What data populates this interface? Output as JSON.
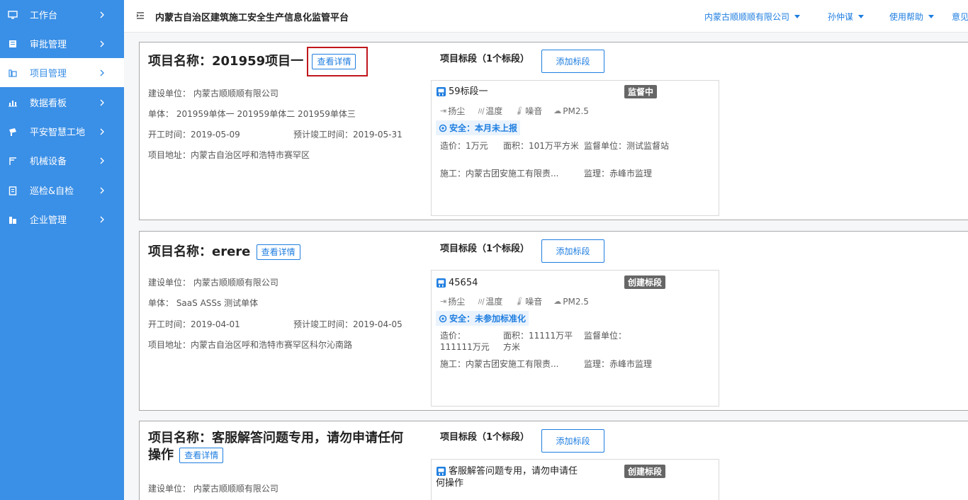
{
  "sidebar": {
    "items": [
      {
        "label": "工作台",
        "icon": "monitor-icon"
      },
      {
        "label": "审批管理",
        "icon": "approval-icon"
      },
      {
        "label": "项目管理",
        "icon": "project-icon"
      },
      {
        "label": "数据看板",
        "icon": "chart-icon"
      },
      {
        "label": "平安智慧工地",
        "icon": "camera-icon"
      },
      {
        "label": "机械设备",
        "icon": "crane-icon"
      },
      {
        "label": "巡检&自检",
        "icon": "clipboard-icon"
      },
      {
        "label": "企业管理",
        "icon": "building-icon"
      }
    ],
    "active_index": 2
  },
  "header": {
    "title": "内蒙古自治区建筑施工安全生产信息化监管平台",
    "company": "内蒙古顺顺顺有限公司",
    "user": "孙仲谋",
    "help": "使用帮助",
    "feedback": "意见"
  },
  "colors": {
    "sidebar": "#3a8fe6",
    "accent": "#1f7ee0",
    "highlight": "#c0171c"
  },
  "projects": [
    {
      "title": "项目名称：201959项目一",
      "detail_label": "查看详情",
      "builder": "建设单位：  内蒙古顺顺顺有限公司",
      "units": "单体：   201959单体一  201959单体二  201959单体三",
      "start": "开工时间：2019-05-09",
      "finish": "预计竣工时间：2019-05-31",
      "address": "项目地址：内蒙古自治区呼和浩特市赛罕区",
      "seg_head": "项目标段（1个标段）",
      "add_seg": "添加标段",
      "segment": {
        "name": "59标段一",
        "badge": "监督中",
        "sensors": [
          "扬尘",
          "温度",
          "噪音",
          "PM2.5"
        ],
        "safety": "安全：本月未上报",
        "cost": "造价：1万元",
        "area": "面积：101万平方米",
        "supervisor_unit": "监督单位：测试监督站",
        "contractor": "施工：内蒙古团安施工有限责...",
        "supervision": "监理：赤峰市监理"
      }
    },
    {
      "title": "项目名称：erere",
      "detail_label": "查看详情",
      "builder": "建设单位：  内蒙古顺顺顺有限公司",
      "units": "单体：   SaaS   ASSs   测试单体",
      "start": "开工时间：2019-04-01",
      "finish": "预计竣工时间：2019-04-05",
      "address": "项目地址：内蒙古自治区呼和浩特市赛罕区科尔沁南路",
      "seg_head": "项目标段（1个标段）",
      "add_seg": "添加标段",
      "segment": {
        "name": "45654",
        "badge": "创建标段",
        "sensors": [
          "扬尘",
          "温度",
          "噪音",
          "PM2.5"
        ],
        "safety": "安全：未参加标准化",
        "cost": "造价：111111万元",
        "area": "面积：11111万平方米",
        "supervisor_unit": "监督单位：",
        "contractor": "施工：内蒙古团安施工有限责...",
        "supervision": "监理：赤峰市监理"
      }
    },
    {
      "title_line1": "项目名称：客服解答问题专用，请勿申请任何",
      "title_line2": "操作",
      "detail_label": "查看详情",
      "builder": "建设单位：  内蒙古顺顺顺有限公司",
      "seg_head": "项目标段（1个标段）",
      "add_seg": "添加标段",
      "segment": {
        "name_line1": "客服解答问题专用，请勿申请任",
        "name_line2": "何操作",
        "badge": "创建标段"
      }
    }
  ]
}
